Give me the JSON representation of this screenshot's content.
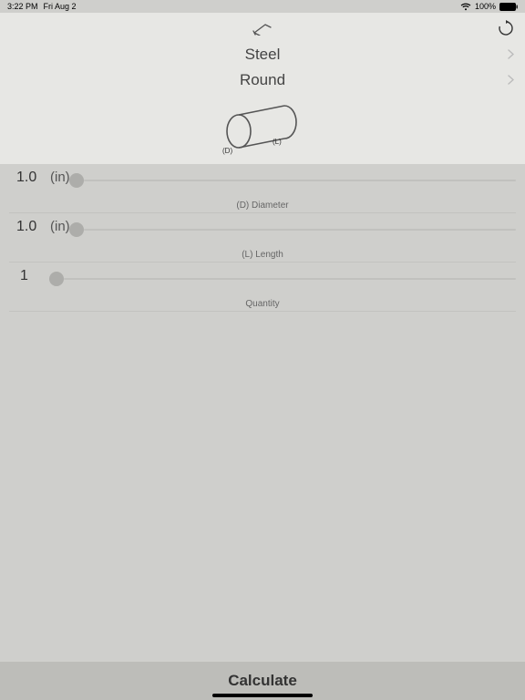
{
  "status_bar": {
    "time": "3:22 PM",
    "date": "Fri Aug 2",
    "battery_pct": "100%"
  },
  "header": {
    "material": "Steel",
    "shape": "Round"
  },
  "diagram": {
    "d_label": "(D)",
    "l_label": "(L)"
  },
  "params": {
    "diameter": {
      "value": "1.0",
      "unit": "(in)",
      "label": "(D) Diameter"
    },
    "length": {
      "value": "1.0",
      "unit": "(in)",
      "label": "(L) Length"
    },
    "quantity": {
      "value": "1",
      "label": "Quantity"
    }
  },
  "footer": {
    "calculate": "Calculate"
  }
}
